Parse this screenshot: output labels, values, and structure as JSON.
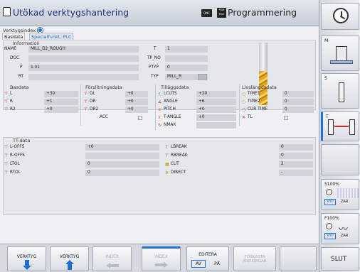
{
  "header": {
    "title": "Utökad verktygshantering",
    "dnc": "DNC",
    "pgm_badge": "PGM MGT",
    "mode": "Programmering"
  },
  "tool_index": {
    "label": "Verktygsindex",
    "tabs": [
      "Basdata",
      "Specialfunkt. PLC"
    ]
  },
  "information": {
    "title": "Information",
    "rows": [
      {
        "label": "NAME",
        "value": "MILL_D2_ROUGH"
      },
      {
        "label": "DOC",
        "value": ""
      },
      {
        "label": "P",
        "value": "1.01"
      },
      {
        "label": "RT",
        "value": ""
      }
    ],
    "right": [
      {
        "label": "T",
        "value": "1"
      },
      {
        "label": "TP_NO",
        "value": ""
      },
      {
        "label": "PTYP",
        "value": "0"
      },
      {
        "label": "TYP",
        "value": "MILL_R"
      }
    ]
  },
  "basdata": {
    "title": "Basdata",
    "rows": [
      {
        "label": "L",
        "value": "+30"
      },
      {
        "label": "R",
        "value": "+1"
      },
      {
        "label": "R2",
        "value": "+0"
      }
    ]
  },
  "forslitning": {
    "title": "Förslitningsdata",
    "rows": [
      {
        "label": "DL",
        "value": "+0"
      },
      {
        "label": "DR",
        "value": "+0"
      },
      {
        "label": "DR2",
        "value": "+0"
      },
      {
        "label": "ACC",
        "value": ""
      }
    ]
  },
  "tillagg": {
    "title": "Tilläggsdata",
    "rows": [
      {
        "label": "LCUTS",
        "value": "+20"
      },
      {
        "label": "ANGLE",
        "value": "+6"
      },
      {
        "label": "PITCH",
        "value": "+0"
      },
      {
        "label": "T-ANGLE",
        "value": "+0"
      },
      {
        "label": "NMAX",
        "value": ""
      }
    ]
  },
  "livslangd": {
    "title": "Livslängdsdata",
    "rows": [
      {
        "label": "TIME1",
        "value": "0"
      },
      {
        "label": "TIME2",
        "value": "0"
      },
      {
        "label": "CUR TIME",
        "value": "0"
      },
      {
        "label": "TL",
        "value": ""
      }
    ]
  },
  "ttdata": {
    "title": "TT-data",
    "left": [
      {
        "label": "L-OFFS",
        "value": "+0"
      },
      {
        "label": "R-OFFS",
        "value": ""
      },
      {
        "label": "LTOL",
        "value": "0"
      },
      {
        "label": "RTOL",
        "value": "0"
      }
    ],
    "right": [
      {
        "label": "LBREAK",
        "value": "0"
      },
      {
        "label": "RBREAK",
        "value": "0"
      },
      {
        "label": "CUT",
        "value": "2"
      },
      {
        "label": "DIRECT",
        "value": "-"
      }
    ]
  },
  "bottom": {
    "verktyg_down": "VERKTYG",
    "verktyg_up": "VERKTYG",
    "index_left": "INDEX",
    "index_right": "INDEX",
    "editera": "EDITERA",
    "av": "AV",
    "pa": "PÅ",
    "forkasta_1": "FÖRKASTA",
    "forkasta_2": "ÄNDRINGAR",
    "slut": "SLUT"
  },
  "side": {
    "m_label": "M",
    "s_label": "S",
    "t_label": "T",
    "s100": "S100%",
    "f100": "F100%",
    "vyp1": "VYP",
    "zar1": "ZAR",
    "vyp2": "VYP",
    "zar2": "ZAR"
  }
}
